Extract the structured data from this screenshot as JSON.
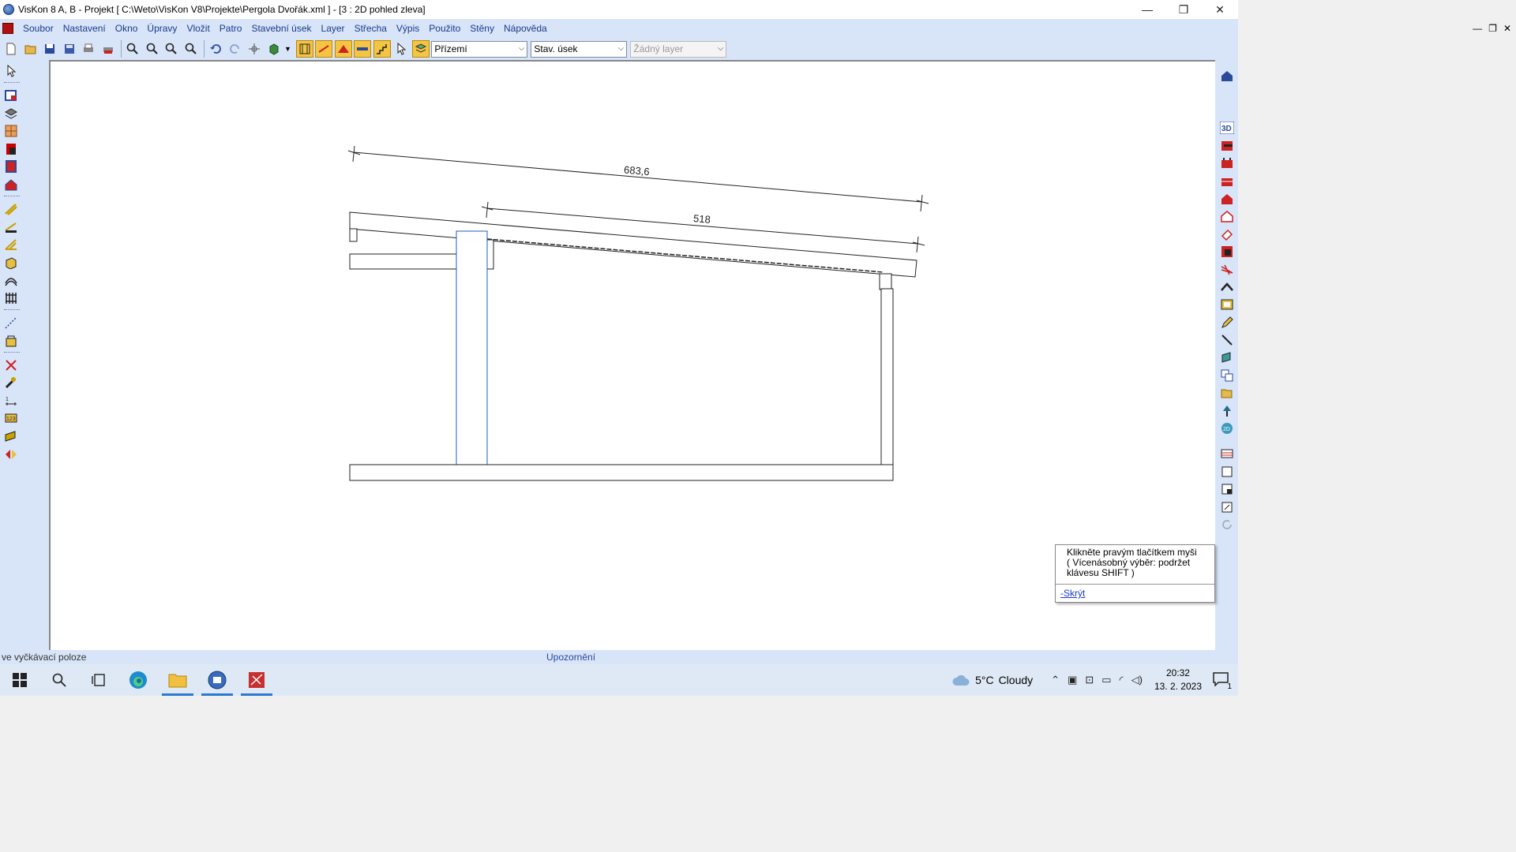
{
  "window": {
    "title": "VisKon 8 A, B - Projekt [ C:\\Weto\\VisKon V8\\Projekte\\Pergola Dvořák.xml ]  - [3 : 2D pohled zleva]",
    "min": "—",
    "max": "❐",
    "close": "✕"
  },
  "menu": {
    "items": [
      "Soubor",
      "Nastavení",
      "Okno",
      "Úpravy",
      "Vložit",
      "Patro",
      "Stavební úsek",
      "Layer",
      "Střecha",
      "Výpis",
      "Použito",
      "Stěny",
      "Nápověda"
    ],
    "mdi_min": "—",
    "mdi_restore": "❐",
    "mdi_close": "✕"
  },
  "toolbar": {
    "floor_select": "Přízemí",
    "section_select": "Stav. úsek",
    "layer_select": "Žádný layer"
  },
  "drawing": {
    "dim_outer": "683,6",
    "dim_inner": "518"
  },
  "tooltip": {
    "line1": "Klikněte pravým tlačítkem myši",
    "line2": "( Vícenásobný výběr: podržet",
    "line3": "klávesu SHIFT )",
    "link": "-Skrýt"
  },
  "status": {
    "left": "ve vyčkávací poloze",
    "center": "Upozornění"
  },
  "taskbar": {
    "weather_temp": "5°C",
    "weather_text": "Cloudy",
    "time": "20:32",
    "date": "13. 2. 2023",
    "notifications": "1"
  },
  "colors": {
    "accent": "#2b79d0",
    "chrome": "#d8e4f8",
    "menu_text": "#1a3a8a"
  }
}
